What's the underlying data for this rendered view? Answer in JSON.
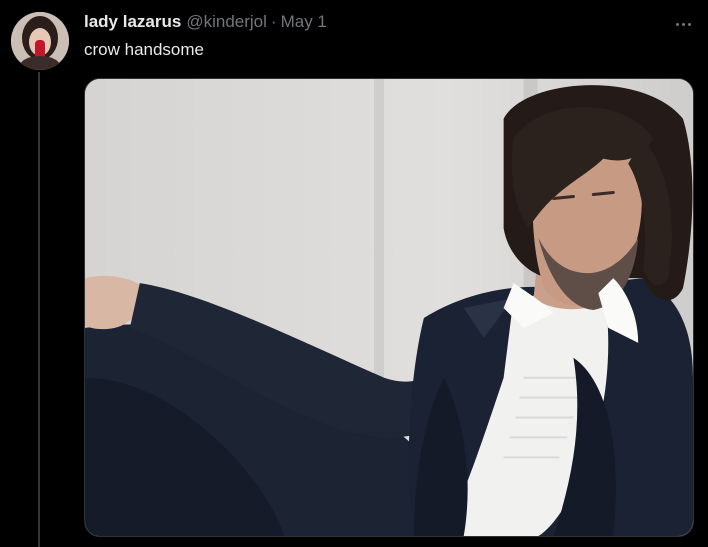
{
  "tweet": {
    "display_name": "lady lazarus",
    "handle": "@kinderjol",
    "separator": "·",
    "date": "May 1",
    "text": "crow handsome"
  },
  "icons": {
    "more": "more-horizontal-icon"
  },
  "colors": {
    "background": "#000000",
    "primary_text": "#e7e9ea",
    "secondary_text": "#71767b",
    "thread_line": "#333639"
  }
}
